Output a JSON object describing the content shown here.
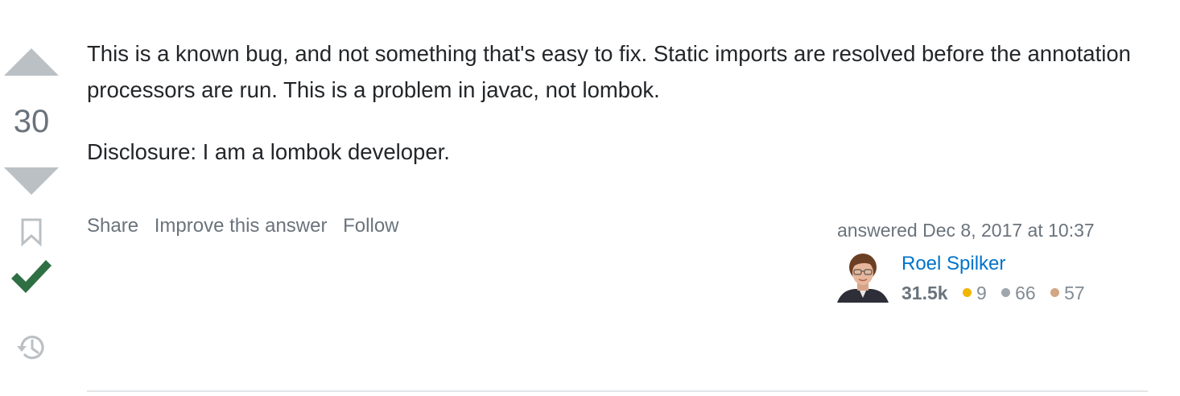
{
  "vote": {
    "count": "30"
  },
  "post": {
    "paragraphs": [
      "This is a known bug, and not something that's easy to fix. Static imports are resolved before the annotation processors are run. This is a problem in javac, not lombok.",
      "Disclosure: I am a lombok developer."
    ]
  },
  "menu": {
    "share_label": "Share",
    "improve_label": "Improve this answer",
    "follow_label": "Follow"
  },
  "user": {
    "action_time": "answered Dec 8, 2017 at 10:37",
    "name": "Roel Spilker",
    "reputation": "31.5k",
    "badges": {
      "gold": "9",
      "silver": "66",
      "bronze": "57"
    }
  },
  "colors": {
    "link": "#0074cc",
    "accepted": "#2f6f44",
    "vote_arrow": "#bbc0c4",
    "gold": "#f1b600",
    "silver": "#9fa6ad",
    "bronze": "#d1a684"
  },
  "icons": {
    "vote_up": "triangle-up-icon",
    "vote_down": "triangle-down-icon",
    "bookmark": "bookmark-icon",
    "accepted": "checkmark-icon",
    "history": "history-icon"
  }
}
